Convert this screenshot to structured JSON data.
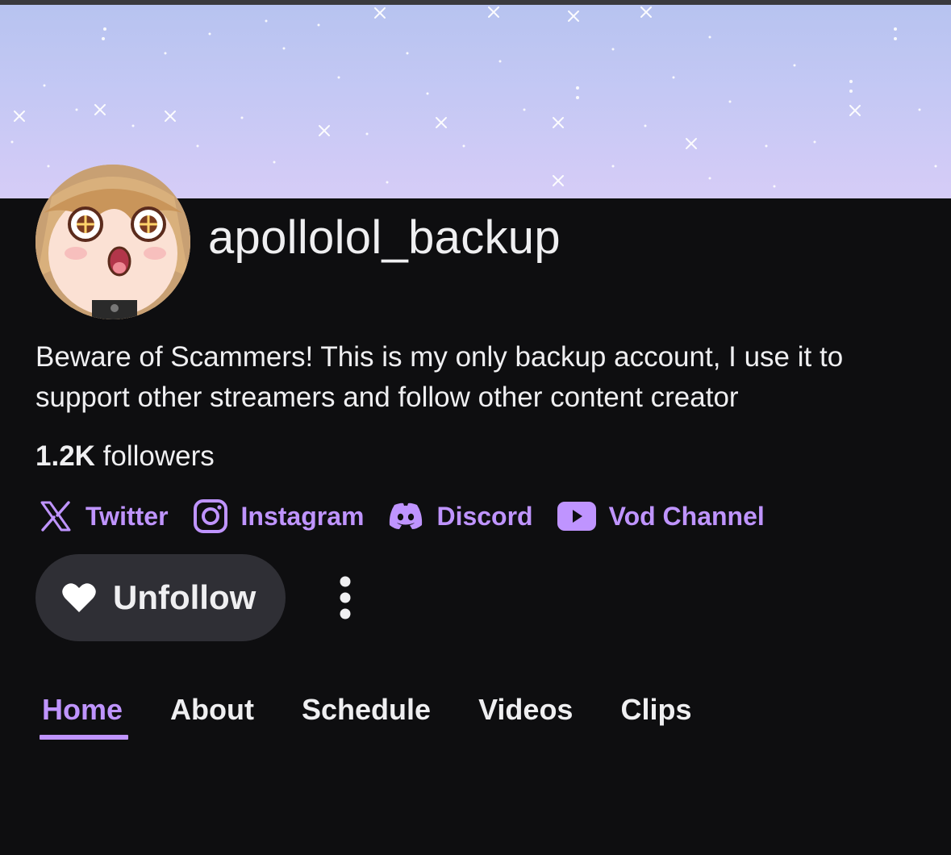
{
  "channel": {
    "username": "apollolol_backup",
    "bio": "Beware of Scammers! This is my only backup account, I use it to support other streamers and follow other content creator",
    "followers_count": "1.2K",
    "followers_label": "followers"
  },
  "socials": [
    {
      "label": "Twitter",
      "icon": "x-logo-icon"
    },
    {
      "label": "Instagram",
      "icon": "instagram-icon"
    },
    {
      "label": "Discord",
      "icon": "discord-icon"
    },
    {
      "label": "Vod Channel",
      "icon": "youtube-icon"
    }
  ],
  "actions": {
    "unfollow_label": "Unfollow",
    "unfollow_icon": "heart-icon",
    "more_icon": "more-vertical-icon"
  },
  "tabs": [
    {
      "label": "Home",
      "active": true
    },
    {
      "label": "About",
      "active": false
    },
    {
      "label": "Schedule",
      "active": false
    },
    {
      "label": "Videos",
      "active": false
    },
    {
      "label": "Clips",
      "active": false
    }
  ],
  "colors": {
    "background": "#0e0e10",
    "accent": "#bf94ff",
    "button_bg": "#2f2f35",
    "text": "#efeff1",
    "banner_top": "#b7c3f0",
    "banner_bottom": "#d6ccf7"
  }
}
